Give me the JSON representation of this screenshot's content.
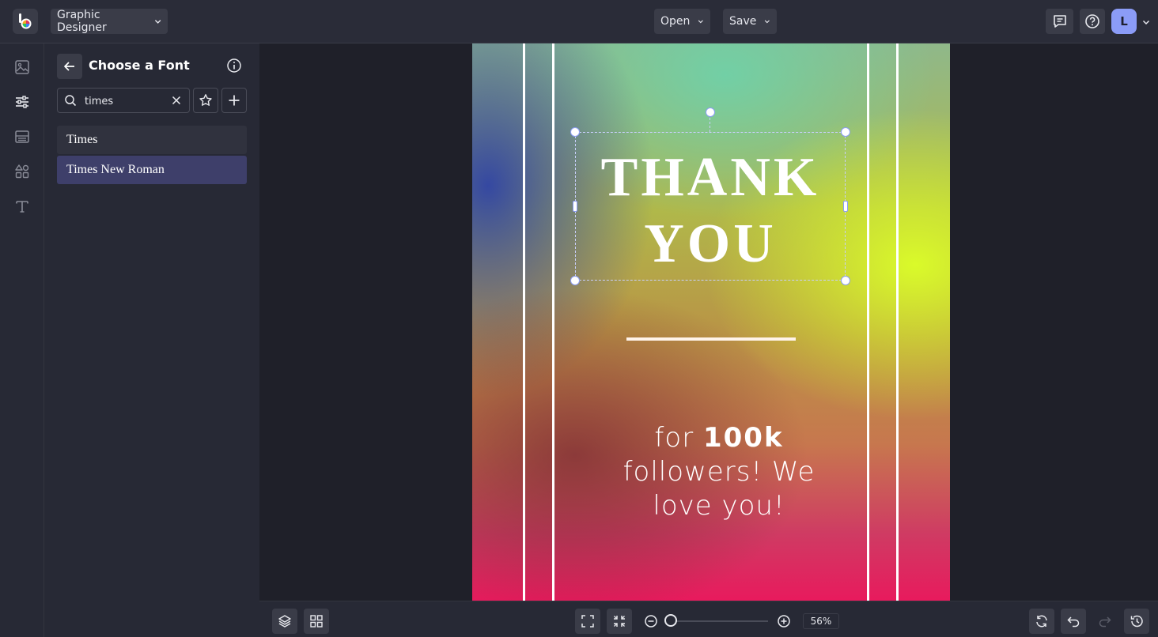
{
  "app": {
    "mode_label": "Graphic Designer",
    "open_label": "Open",
    "save_label": "Save",
    "user_initial": "L"
  },
  "rail": {
    "items": [
      "image-icon",
      "sliders-icon",
      "layout-icon",
      "shapes-icon",
      "text-icon"
    ]
  },
  "panel": {
    "title": "Choose a Font",
    "search_value": "times",
    "fonts": [
      {
        "label": "Times",
        "selected": false
      },
      {
        "label": "Times New Roman",
        "selected": true
      }
    ]
  },
  "design": {
    "headline_line1": "THANK",
    "headline_line2": "YOU",
    "sub_prefix": "for ",
    "sub_bold": "100k",
    "sub_line2": "followers! We",
    "sub_line3": "love you!"
  },
  "bottom": {
    "zoom_label": "56%",
    "zoom_value": 56
  },
  "colors": {
    "accent": "#8b9cf7",
    "selected_font_bg": "#3e3f6a",
    "topbar_bg": "#2a2c38"
  }
}
